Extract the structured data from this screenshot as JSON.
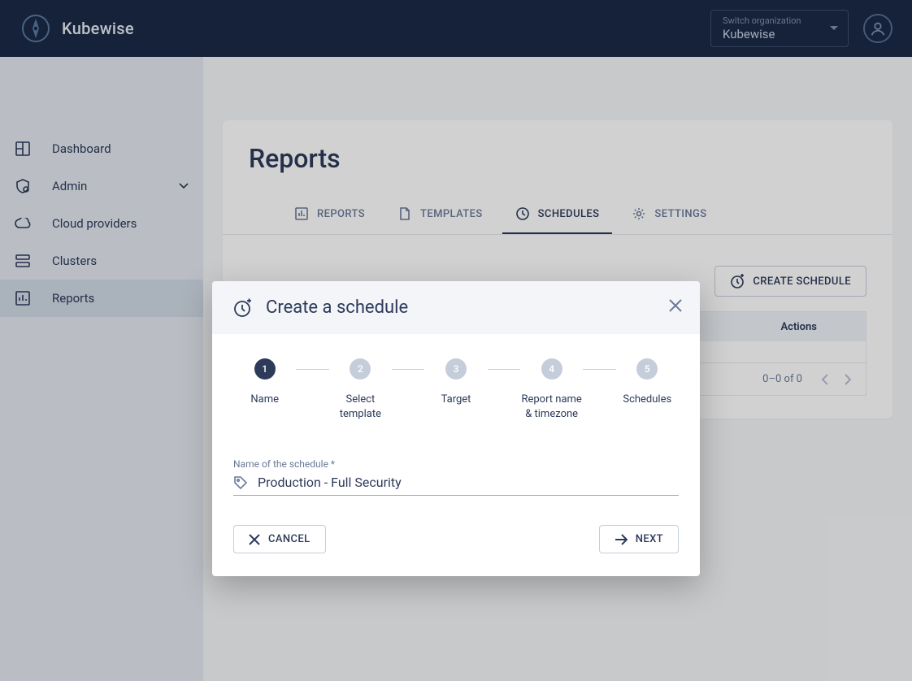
{
  "header": {
    "brand": "Kubewise",
    "org_label": "Switch organization",
    "org_value": "Kubewise"
  },
  "sidebar": {
    "items": [
      {
        "label": "Dashboard"
      },
      {
        "label": "Admin"
      },
      {
        "label": "Cloud providers"
      },
      {
        "label": "Clusters"
      },
      {
        "label": "Reports"
      }
    ]
  },
  "page": {
    "title": "Reports",
    "tabs": [
      {
        "label": "REPORTS"
      },
      {
        "label": "TEMPLATES"
      },
      {
        "label": "SCHEDULES"
      },
      {
        "label": "SETTINGS"
      }
    ],
    "create_btn": "CREATE SCHEDULE",
    "table": {
      "col_actions": "Actions",
      "pagination": "0–0 of 0"
    }
  },
  "dialog": {
    "title": "Create a schedule",
    "steps": [
      {
        "num": "1",
        "label": "Name"
      },
      {
        "num": "2",
        "label": "Select template"
      },
      {
        "num": "3",
        "label": "Target"
      },
      {
        "num": "4",
        "label": "Report name & timezone"
      },
      {
        "num": "5",
        "label": "Schedules"
      }
    ],
    "field_label": "Name of the schedule *",
    "field_value": "Production - Full Security",
    "cancel": "CANCEL",
    "next": "NEXT"
  }
}
